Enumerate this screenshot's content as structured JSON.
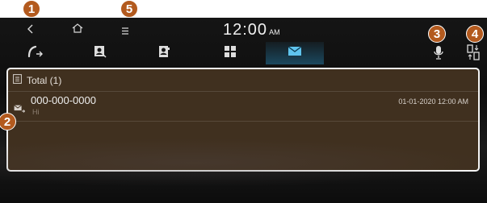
{
  "status": {
    "time": "12:00",
    "ampm": "AM"
  },
  "tabs": [
    {
      "name": "call-history",
      "icon": "phone-transfer-icon",
      "active": false
    },
    {
      "name": "contacts-sync",
      "icon": "contact-card-icon",
      "active": false
    },
    {
      "name": "phonebook",
      "icon": "contact-book-icon",
      "active": false
    },
    {
      "name": "keypad",
      "icon": "keypad-icon",
      "active": false
    },
    {
      "name": "messages",
      "icon": "envelope-icon",
      "active": true
    }
  ],
  "messages": {
    "header_label": "Total (1)",
    "items": [
      {
        "number": "000-000-0000",
        "preview": "Hi",
        "datetime": "01-01-2020 12:00 AM"
      }
    ]
  },
  "callouts": [
    "1",
    "2",
    "3",
    "4",
    "5"
  ],
  "colors": {
    "marker": "#b35a1e",
    "active_tab": "#2e8cbc",
    "panel_bg": "#40301f"
  }
}
